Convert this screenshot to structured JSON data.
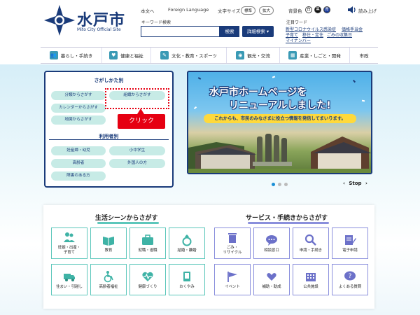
{
  "header": {
    "logo_title": "水戸市",
    "logo_subtitle": "Mito City Official Site",
    "top_links": [
      "本文へ",
      "Foreign Language",
      "文字サイズ"
    ],
    "font_size_options": [
      "標準",
      "拡大"
    ],
    "color_label": "背景色",
    "color_options": [
      "白",
      "黒",
      "青"
    ],
    "read_aloud": "読み上げ",
    "search": {
      "label": "キーワード検索",
      "placeholder": "",
      "button": "検索",
      "advanced_button": "詳細検索 ▾"
    },
    "notice": {
      "label": "注目ワード",
      "links": [
        "新型コロナウイルス感染症",
        "価格手当金",
        "子育て",
        "移住・定住",
        "ごみの収集日",
        "マイナンバー"
      ]
    }
  },
  "nav": {
    "items": [
      {
        "label": "暮らし・手続き",
        "icon": "people-icon"
      },
      {
        "label": "健康と福祉",
        "icon": "health-icon"
      },
      {
        "label": "文化・教育・スポーツ",
        "icon": "culture-icon"
      },
      {
        "label": "観光・交流",
        "icon": "camera-icon"
      },
      {
        "label": "産業・しごと・開発",
        "icon": "building-icon"
      },
      {
        "label": "市政",
        "icon": ""
      }
    ]
  },
  "search_panel": {
    "heading": "さがしかた別",
    "pills": [
      "分類からさがす",
      "組織からさがす",
      "カレンダーからさがす",
      "地図からさがす"
    ],
    "user_heading": "利用者別",
    "user_pills": [
      "妊産婦・幼児",
      "小中学生",
      "高齢者",
      "外国人の方",
      "障害のある方"
    ],
    "callout": "クリック"
  },
  "banner": {
    "title_line1": "水戸市ホームページを",
    "title_line2": "リニューアルしました!",
    "subtitle": "これからも、市民のみなさまに役立つ情報を発信してまいります。",
    "stop_label": "Stop"
  },
  "life_scene": {
    "title": "生活シーンからさがす",
    "accent": "#5cc7bb",
    "tiles": [
      "妊娠・出産・\n子育て",
      "教育",
      "就職・退職",
      "結婚・離婚",
      "住まい・引越し",
      "高齢者福祉",
      "健康づくり",
      "おくやみ"
    ]
  },
  "services": {
    "title": "サービス・手続きからさがす",
    "accent": "#8a8fdc",
    "tiles": [
      "ごみ・\nリサイクル",
      "相談窓口",
      "申請・手続き",
      "電子申請",
      "イベント",
      "補助・助成",
      "公共施設",
      "よくある質問"
    ]
  }
}
